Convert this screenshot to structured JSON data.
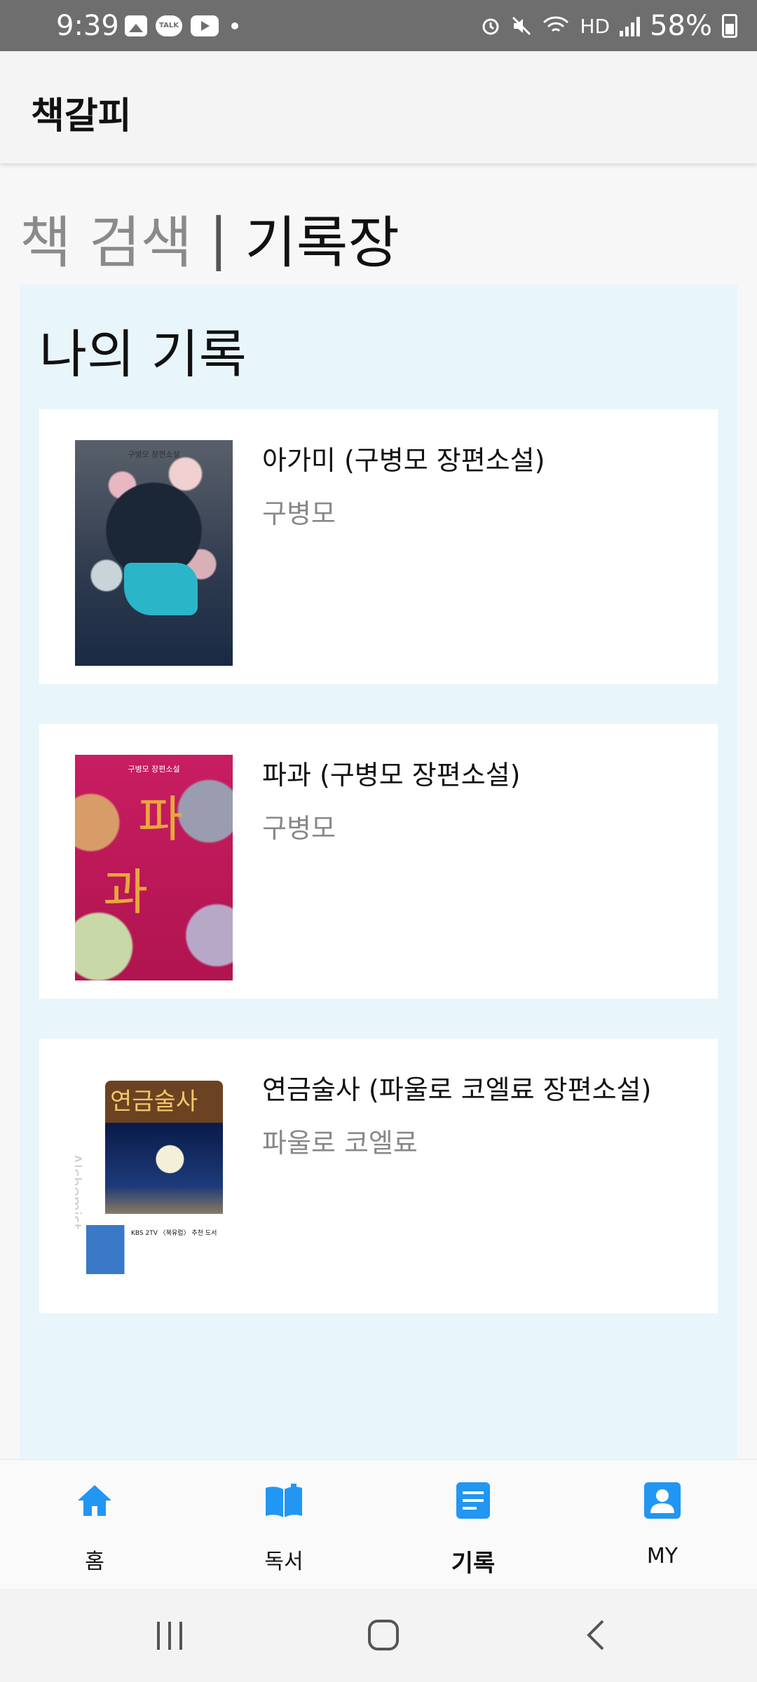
{
  "status_bar": {
    "time": "9:39",
    "talk_label": "TALK",
    "hd_label": "HD",
    "battery": "58%"
  },
  "app_bar": {
    "title": "책갈피"
  },
  "header_tabs": {
    "search_label": "책 검색",
    "separator": "|",
    "record_label": "기록장"
  },
  "panel": {
    "title": "나의 기록"
  },
  "books": [
    {
      "title": "아가미 (구병모 장편소설)",
      "author": "구병모"
    },
    {
      "title": "파과 (구병모 장편소설)",
      "author": "구병모"
    },
    {
      "title": "연금술사 (파울로 코엘료 장편소설)",
      "author": "파울로 코엘료"
    }
  ],
  "covers": {
    "c1_caption": "구병모 장편소설",
    "c2_caption": "구병모 장편소설",
    "c2_chars": [
      "파",
      "과"
    ],
    "c3_title": "연금술사",
    "c3_side": "Alchemist",
    "c3_band": "KBS 2TV 〈북유럽〉 추천 도서"
  },
  "bottom_nav": [
    {
      "label": "홈",
      "icon": "home-icon"
    },
    {
      "label": "독서",
      "icon": "book-open-icon"
    },
    {
      "label": "기록",
      "icon": "document-icon"
    },
    {
      "label": "MY",
      "icon": "user-icon"
    }
  ],
  "colors": {
    "accent": "#2196f3",
    "panel_bg": "#e8f6fc",
    "status_bar": "#6e6e6e"
  }
}
